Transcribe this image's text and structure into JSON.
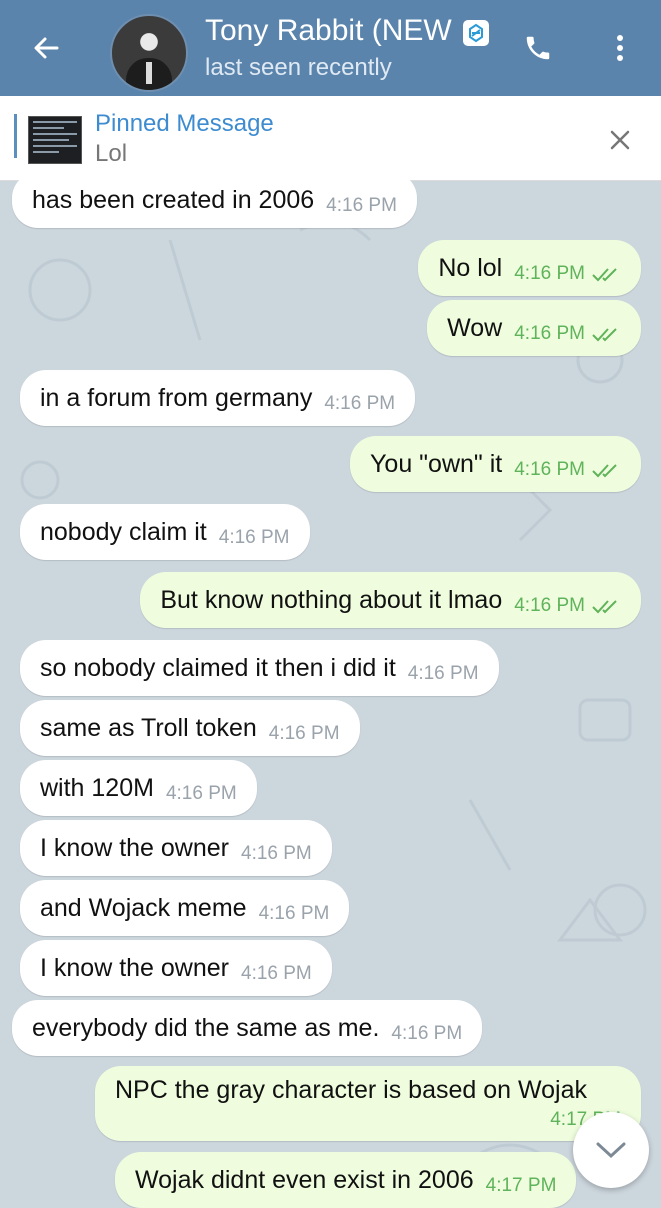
{
  "header": {
    "title": "Tony Rabbit (NEW",
    "status": "last seen recently",
    "icons": [
      "back-arrow-icon",
      "avatar",
      "verified-icon",
      "phone-icon",
      "more-vert-icon"
    ]
  },
  "pinned": {
    "title": "Pinned Message",
    "text": "Lol"
  },
  "messages": [
    {
      "dir": "in",
      "text": "has been created in 2006",
      "time": "4:16 PM"
    },
    {
      "dir": "out",
      "text": "No lol",
      "time": "4:16 PM",
      "read": true
    },
    {
      "dir": "out",
      "text": "Wow",
      "time": "4:16 PM",
      "read": true
    },
    {
      "dir": "in",
      "text": "in a forum from germany",
      "time": "4:16 PM"
    },
    {
      "dir": "out",
      "text": "You \"own\" it",
      "time": "4:16 PM",
      "read": true
    },
    {
      "dir": "in",
      "text": "nobody claim it",
      "time": "4:16 PM"
    },
    {
      "dir": "out",
      "text": "But know nothing about it lmao",
      "time": "4:16 PM",
      "read": true
    },
    {
      "dir": "in",
      "text": "so nobody claimed it then i did it",
      "time": "4:16 PM"
    },
    {
      "dir": "in",
      "text": "same as Troll token",
      "time": "4:16 PM"
    },
    {
      "dir": "in",
      "text": "with 120M",
      "time": "4:16 PM"
    },
    {
      "dir": "in",
      "text": "I know the owner",
      "time": "4:16 PM"
    },
    {
      "dir": "in",
      "text": "and Wojack meme",
      "time": "4:16 PM"
    },
    {
      "dir": "in",
      "text": "I know the owner",
      "time": "4:16 PM"
    },
    {
      "dir": "in",
      "text": "everybody did the same as me.",
      "time": "4:16 PM"
    },
    {
      "dir": "out",
      "text": "NPC the gray character is based on Wojak",
      "time": "4:17 PM"
    },
    {
      "dir": "out",
      "text": "Wojak didnt even exist in 2006",
      "time": "4:17 PM"
    }
  ],
  "colors": {
    "header": "#5a84ac",
    "incoming": "#ffffff",
    "outgoing": "#effdde",
    "tick": "#5fb35b",
    "link": "#3d8bd0"
  }
}
